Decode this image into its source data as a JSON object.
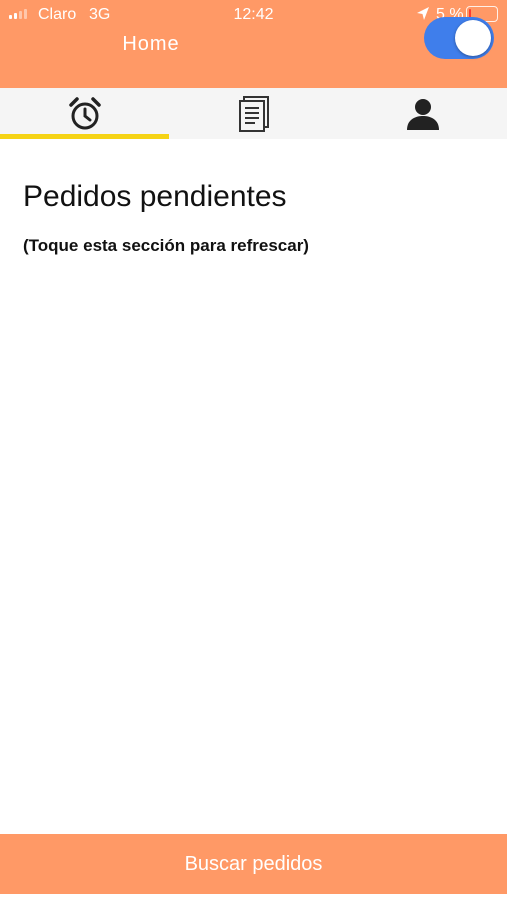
{
  "status_bar": {
    "carrier": "Claro",
    "network": "3G",
    "time": "12:42",
    "battery_percent": "5 %"
  },
  "header": {
    "title": "Home",
    "toggle_on": true
  },
  "tabs": [
    {
      "icon": "alarm-clock-icon",
      "selected": true
    },
    {
      "icon": "document-list-icon",
      "selected": false
    },
    {
      "icon": "person-icon",
      "selected": false
    }
  ],
  "content": {
    "title": "Pedidos pendientes",
    "hint": "(Toque esta sección para refrescar)"
  },
  "bottom_button": {
    "label": "Buscar pedidos"
  },
  "colors": {
    "primary": "#FF9966",
    "toggle_accent": "#3F7EEB",
    "tab_indicator": "#F5D315",
    "tab_background": "#F5F5F5"
  }
}
